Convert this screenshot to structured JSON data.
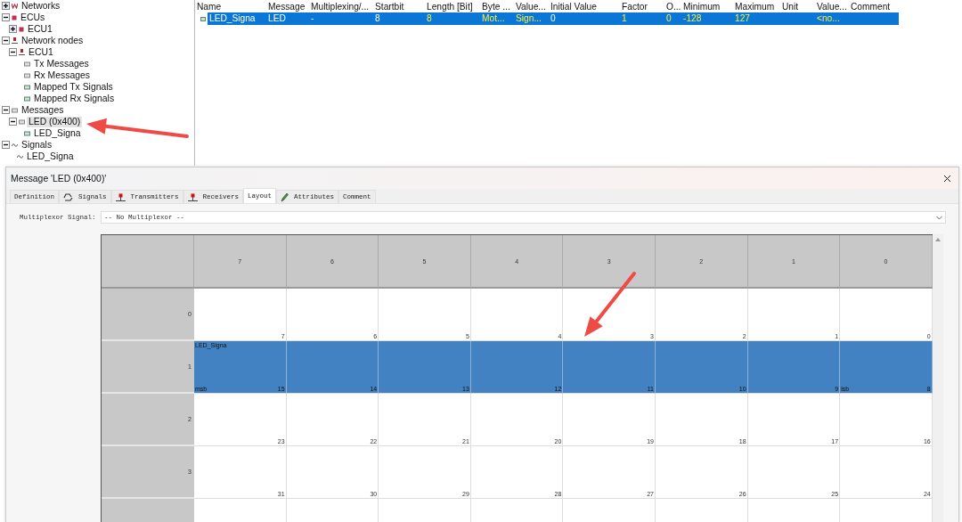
{
  "tree": [
    {
      "label": "Networks",
      "kind": "network",
      "expanded": false,
      "selected": false
    },
    {
      "label": "ECUs",
      "kind": "ecu",
      "expanded": true,
      "selected": false,
      "children": [
        {
          "label": "ECU1",
          "kind": "ecu",
          "expanded": false,
          "selected": false
        }
      ]
    },
    {
      "label": "Network nodes",
      "kind": "node",
      "expanded": true,
      "selected": false,
      "children": [
        {
          "label": "ECU1",
          "kind": "node",
          "expanded": true,
          "selected": false,
          "children": [
            {
              "label": "Tx Messages",
              "kind": "message",
              "selected": false
            },
            {
              "label": "Rx Messages",
              "kind": "message",
              "selected": false
            },
            {
              "label": "Mapped Tx Signals",
              "kind": "signal-map",
              "selected": false
            },
            {
              "label": "Mapped Rx Signals",
              "kind": "signal-map",
              "selected": false
            }
          ]
        }
      ]
    },
    {
      "label": "Messages",
      "kind": "message",
      "expanded": true,
      "selected": false,
      "children": [
        {
          "label": "LED (0x400)",
          "kind": "message",
          "expanded": true,
          "selected": true,
          "children": [
            {
              "label": "LED_Signa",
              "kind": "signal-map",
              "selected": false
            }
          ]
        }
      ]
    },
    {
      "label": "Signals",
      "kind": "signal",
      "expanded": true,
      "selected": false,
      "children": [
        {
          "label": "LED_Signa",
          "kind": "signal",
          "selected": false
        }
      ]
    }
  ],
  "signal_table": {
    "columns": [
      "Name",
      "Message",
      "Multiplexing/...",
      "Startbit",
      "Length [Bit]",
      "Byte ...",
      "Value...",
      "Initial Value",
      "Factor",
      "O...",
      "Minimum",
      "Maximum",
      "Unit",
      "Value...",
      "Comment"
    ],
    "rows": [
      {
        "selected": true,
        "cells": [
          {
            "text": "LED_Signa",
            "highlighted": false
          },
          {
            "text": "LED",
            "highlighted": false
          },
          {
            "text": "-",
            "highlighted": false
          },
          {
            "text": "8",
            "highlighted": false
          },
          {
            "text": "8",
            "highlighted": true
          },
          {
            "text": "Mot...",
            "highlighted": true
          },
          {
            "text": "Sign...",
            "highlighted": true
          },
          {
            "text": "0",
            "highlighted": false
          },
          {
            "text": "1",
            "highlighted": true
          },
          {
            "text": "0",
            "highlighted": true
          },
          {
            "text": "-128",
            "highlighted": true
          },
          {
            "text": "127",
            "highlighted": true
          },
          null,
          {
            "text": "<no...",
            "highlighted": true
          },
          null
        ]
      }
    ]
  },
  "dialog": {
    "title": "Message 'LED (0x400)'",
    "tabs": [
      {
        "label": "Definition",
        "kind": "plain",
        "selected": false
      },
      {
        "label": "Signals",
        "kind": "signals",
        "selected": false
      },
      {
        "label": "Transmitters",
        "kind": "node",
        "selected": false
      },
      {
        "label": "Receivers",
        "kind": "node",
        "selected": false
      },
      {
        "label": "Layout",
        "kind": "plain",
        "selected": true
      },
      {
        "label": "Attributes",
        "kind": "attributes",
        "selected": false
      },
      {
        "label": "Comment",
        "kind": "plain",
        "selected": false
      }
    ],
    "multiplexor": {
      "label": "Multiplexor Signal:",
      "value": "-- No Multiplexor --"
    },
    "layout": {
      "column_headers": [
        "7",
        "6",
        "5",
        "4",
        "3",
        "2",
        "1",
        "0"
      ],
      "rows": [
        {
          "label": "0",
          "filled": false,
          "bits": [
            "7",
            "6",
            "5",
            "4",
            "3",
            "2",
            "1",
            "0"
          ]
        },
        {
          "label": "1",
          "filled": true,
          "signal": "LED_Signa",
          "msb_label": "msb",
          "lsb_label": "lsb",
          "bits": [
            "15",
            "14",
            "13",
            "12",
            "11",
            "10",
            "9",
            "8"
          ]
        },
        {
          "label": "2",
          "filled": false,
          "bits": [
            "23",
            "22",
            "21",
            "20",
            "19",
            "18",
            "17",
            "16"
          ]
        },
        {
          "label": "3",
          "filled": false,
          "bits": [
            "31",
            "30",
            "29",
            "28",
            "27",
            "26",
            "25",
            "24"
          ]
        },
        {
          "filled": false
        }
      ]
    }
  },
  "annotations": [
    {
      "kind": "arrow"
    },
    {
      "kind": "arrow"
    }
  ]
}
